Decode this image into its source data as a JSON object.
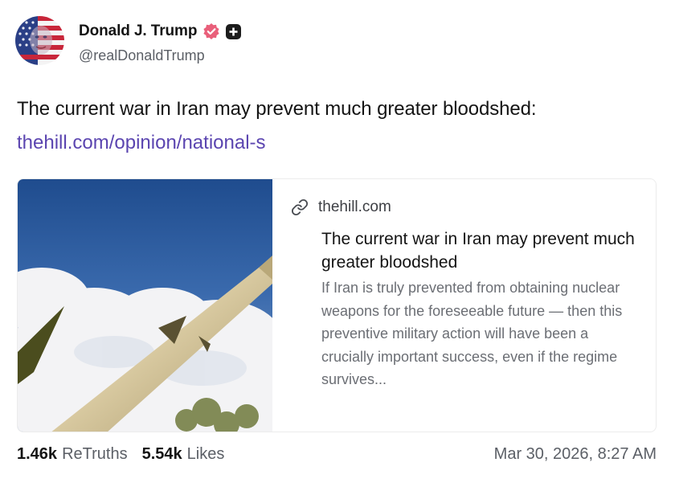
{
  "author": {
    "display_name": "Donald J. Trump",
    "handle": "@realDonaldTrump",
    "avatar_icon": "flag-portrait-avatar",
    "verified_icon": "verified-badge-icon",
    "verified_color": "#e95f7a",
    "extra_badge_icon": "plus-badge-icon"
  },
  "post": {
    "text": "The current war in Iran may prevent much greater bloodshed:",
    "link_text": "thehill.com/opinion/national-s",
    "link_color": "#5b45b0"
  },
  "card": {
    "image_icon": "missile-sky-image",
    "domain_icon": "link-icon",
    "domain": "thehill.com",
    "title": "The current war in Iran may prevent much greater bloodshed",
    "description": "If Iran is truly prevented from obtaining nuclear weapons for the foreseeable future — then this preventive military action will have been a crucially important success, even if the regime survives..."
  },
  "stats": {
    "retruths_count": "1.46k",
    "retruths_label": "ReTruths",
    "likes_count": "5.54k",
    "likes_label": "Likes",
    "timestamp": "Mar 30, 2026, 8:27 AM"
  }
}
